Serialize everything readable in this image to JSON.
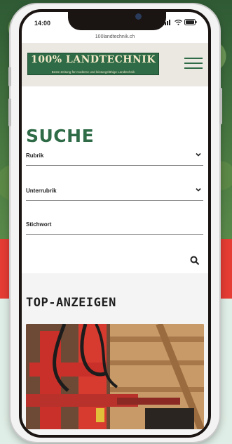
{
  "status": {
    "time": "14:00"
  },
  "browser": {
    "url": "100landtechnik.ch"
  },
  "header": {
    "logo_text": "100% LANDTECHNIK",
    "logo_subtitle": "Beste Zeitung für moderne und leistungsfähige Landtechnik"
  },
  "search": {
    "title": "SUCHE",
    "rubrik_label": "Rubrik",
    "unterrubrik_label": "Unterrubrik",
    "stichwort_label": "Stichwort"
  },
  "listing": {
    "title": "TOP-ANZEIGEN"
  },
  "colors": {
    "accent": "#2e6b46",
    "red_band": "#e53c33",
    "mint": "#dfeee6"
  },
  "icons": {
    "menu": "hamburger-icon",
    "search": "search-icon",
    "dropdown": "chevron-down-icon"
  }
}
